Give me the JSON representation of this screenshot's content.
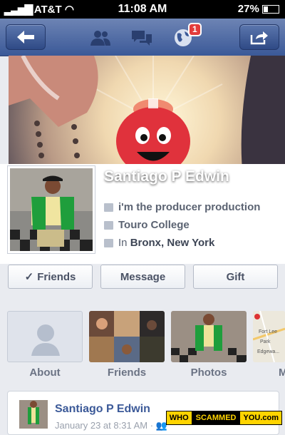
{
  "status": {
    "carrier": "AT&T",
    "time": "11:08 AM",
    "battery": "27%"
  },
  "nav": {
    "badge_count": "1"
  },
  "profile": {
    "name": "Santiago P Edwin",
    "work": "i'm the producer production",
    "school": "Touro College",
    "location_prefix": "In",
    "location": "Bronx, New York"
  },
  "actions": {
    "friends": "Friends",
    "message": "Message",
    "gift": "Gift"
  },
  "tiles": {
    "about": "About",
    "friends": "Friends",
    "photos": "Photos",
    "more": "M"
  },
  "map": {
    "label1": "Fort Lee",
    "label2": "Park",
    "label3": "Edgewa..."
  },
  "post": {
    "author": "Santiago P Edwin",
    "time": "January 23 at 8:31 AM · "
  },
  "watermark": {
    "who": "WHO",
    "scammed": "SCAMMED",
    "you": "YOU.com"
  }
}
